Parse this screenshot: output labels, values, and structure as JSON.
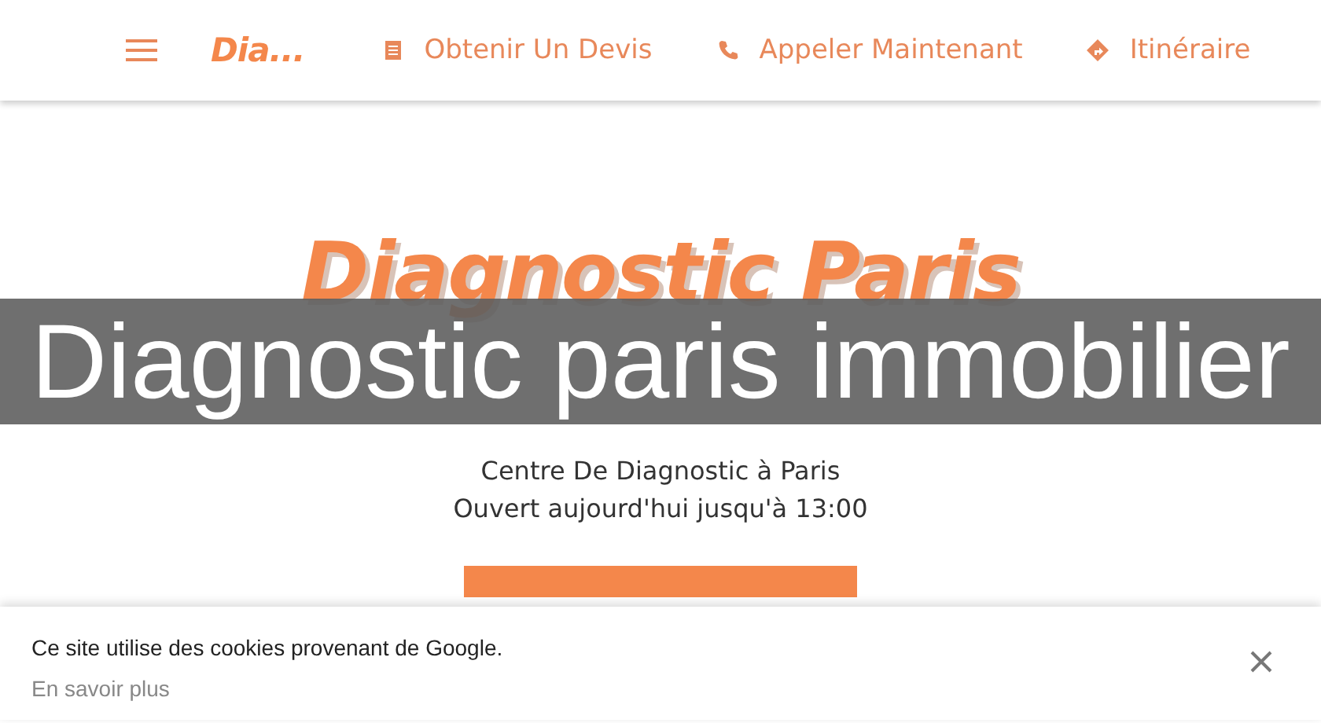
{
  "header": {
    "brand": "Dia...",
    "nav": [
      {
        "kind": "quote",
        "label": "Obtenir Un Devis"
      },
      {
        "kind": "phone",
        "label": "Appeler Maintenant"
      },
      {
        "kind": "directions",
        "label": "Itinéraire"
      }
    ]
  },
  "hero": {
    "title": "Diagnostic Paris",
    "subtitle": "Centre De Diagnostic à Paris",
    "hours": "Ouvert aujourd'hui jusqu'à 13:00"
  },
  "caption_banner": "Diagnostic paris immobilier",
  "cookie_notice": {
    "text": "Ce site utilise des cookies provenant de Google.",
    "link": "En savoir plus"
  }
}
